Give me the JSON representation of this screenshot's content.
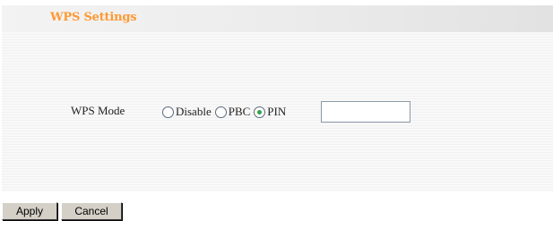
{
  "header": {
    "title": "WPS Settings",
    "title_color": "#ff9933"
  },
  "form": {
    "wps_mode_label": "WPS Mode",
    "options": [
      {
        "label": "Disable",
        "checked": false
      },
      {
        "label": "PBC",
        "checked": false
      },
      {
        "label": "PIN",
        "checked": true
      }
    ],
    "pin_value": ""
  },
  "actions": {
    "apply_label": "Apply",
    "cancel_label": "Cancel"
  }
}
